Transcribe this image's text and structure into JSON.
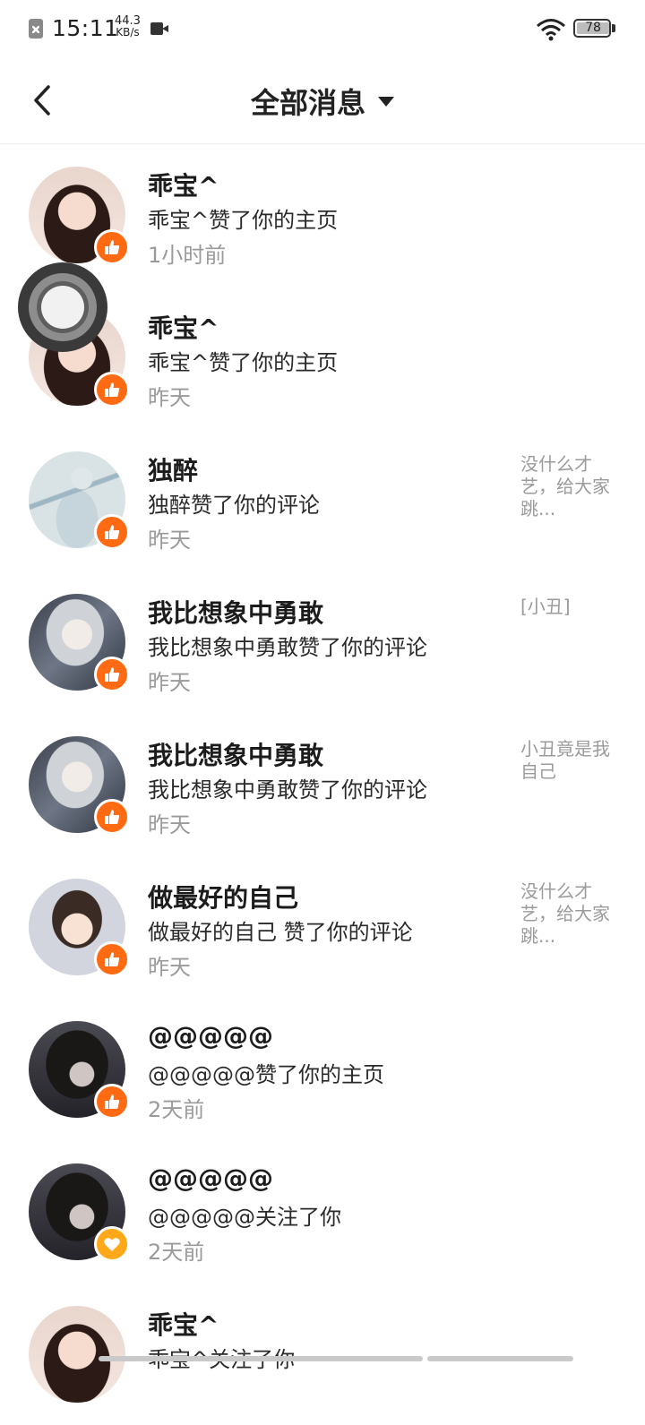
{
  "status_bar": {
    "time": "15:11",
    "net_speed_value": "44.3",
    "net_speed_unit": "KB/s",
    "battery": "78"
  },
  "header": {
    "title": "全部消息"
  },
  "colors": {
    "like_badge": "#ff6a13",
    "follow_badge": "#ffa81a",
    "secondary_text": "#9a9a9a"
  },
  "messages": [
    {
      "name": "乖宝^",
      "action": "乖宝^赞了你的主页",
      "time": "1小时前",
      "preview": "",
      "badge": "thumbs-up-icon"
    },
    {
      "name": "乖宝^",
      "action": "乖宝^赞了你的主页",
      "time": "昨天",
      "preview": "",
      "badge": "thumbs-up-icon"
    },
    {
      "name": "独醉",
      "action": "独醉赞了你的评论",
      "time": "昨天",
      "preview": "没什么才艺，给大家跳...",
      "badge": "thumbs-up-icon"
    },
    {
      "name": "我比想象中勇敢",
      "action": "我比想象中勇敢赞了你的评论",
      "time": "昨天",
      "preview": "[小丑]",
      "badge": "thumbs-up-icon"
    },
    {
      "name": "我比想象中勇敢",
      "action": "我比想象中勇敢赞了你的评论",
      "time": "昨天",
      "preview": "小丑竟是我自己",
      "badge": "thumbs-up-icon"
    },
    {
      "name": "做最好的自己",
      "action": "做最好的自己 赞了你的评论",
      "time": "昨天",
      "preview": "没什么才艺，给大家跳...",
      "badge": "thumbs-up-icon"
    },
    {
      "name": "@@@@@",
      "action": "@@@@@赞了你的主页",
      "time": "2天前",
      "preview": "",
      "badge": "thumbs-up-icon"
    },
    {
      "name": "@@@@@",
      "action": "@@@@@关注了你",
      "time": "2天前",
      "preview": "",
      "badge": "heart-icon"
    },
    {
      "name": "乖宝^",
      "action": "乖宝^关注了你",
      "time": "",
      "preview": "",
      "badge": "heart-icon"
    }
  ]
}
